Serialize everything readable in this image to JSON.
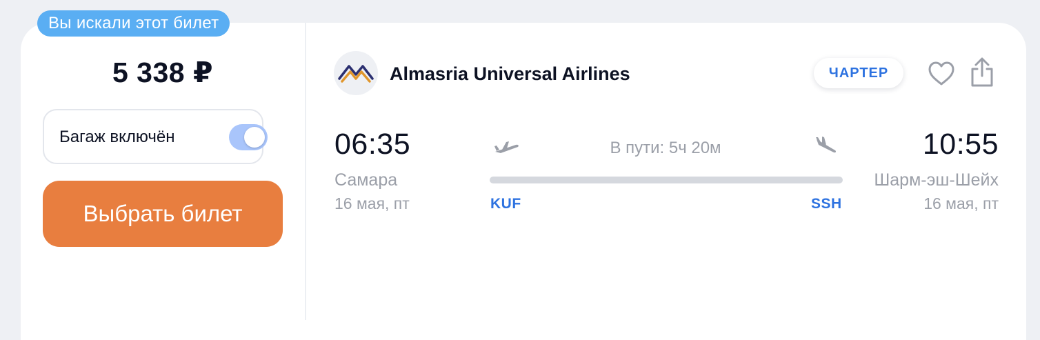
{
  "badge": {
    "searched_label": "Вы искали этот билет"
  },
  "price": {
    "amount": "5 338 ₽"
  },
  "baggage": {
    "label": "Багаж включён",
    "enabled": true
  },
  "actions": {
    "select_label": "Выбрать билет"
  },
  "airline": {
    "name": "Almasria Universal Airlines",
    "logo_icon": "almasria-logo-icon"
  },
  "flight_type": {
    "label": "ЧАРТЕР"
  },
  "departure": {
    "time": "06:35",
    "city": "Самара",
    "date": "16 мая, пт",
    "iata": "KUF"
  },
  "arrival": {
    "time": "10:55",
    "city": "Шарм-эш-Шейх",
    "date": "16 мая, пт",
    "iata": "SSH"
  },
  "duration": {
    "label": "В пути: 5ч 20м"
  },
  "icons": {
    "favorite": "heart-icon",
    "share": "share-icon",
    "takeoff": "takeoff-icon",
    "landing": "landing-icon"
  },
  "colors": {
    "accent": "#e87e3f",
    "badge": "#5aaef3",
    "link": "#2d72e0",
    "toggle_on": "#a9c5fb"
  }
}
